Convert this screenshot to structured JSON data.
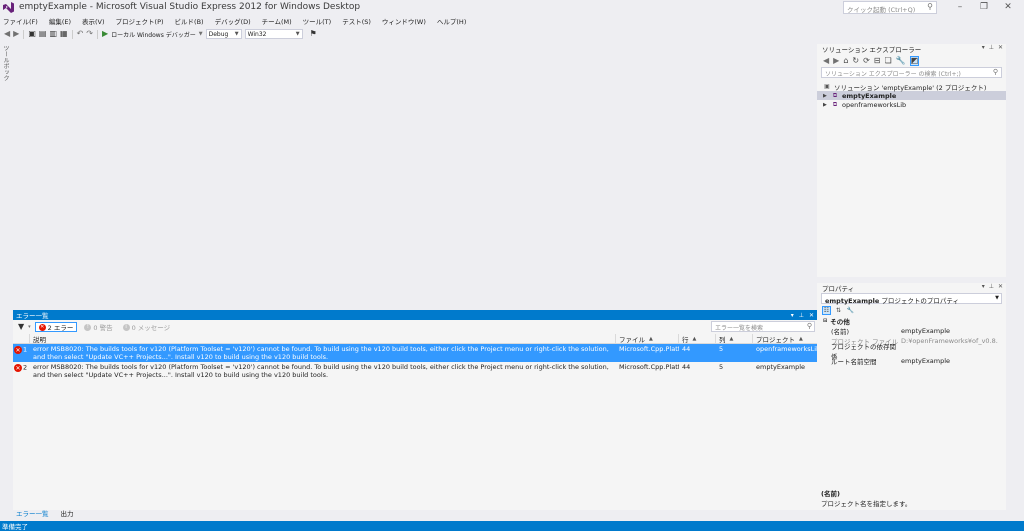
{
  "window": {
    "title": "emptyExample - Microsoft Visual Studio Express 2012 for Windows Desktop",
    "quick_launch_placeholder": "クイック起動 (Ctrl+Q)",
    "controls": [
      "minimize",
      "restore",
      "close"
    ]
  },
  "menu": [
    "ファイル(F)",
    "編集(E)",
    "表示(V)",
    "プロジェクト(P)",
    "ビルド(B)",
    "デバッグ(D)",
    "チーム(M)",
    "ツール(T)",
    "テスト(S)",
    "ウィンドウ(W)",
    "ヘルプ(H)"
  ],
  "toolbar": {
    "debugger_label": "ローカル Windows デバッガー",
    "configuration": "Debug",
    "platform": "Win32"
  },
  "toolbox_tab": "ツールボックス",
  "solution_explorer": {
    "title": "ソリューション エクスプローラー",
    "search_placeholder": "ソリューション エクスプローラー の検索 (Ctrl+;)",
    "items": [
      {
        "label": "ソリューション 'emptyExample' (2 プロジェクト)",
        "level": 0,
        "selected": false,
        "bold": false
      },
      {
        "label": "emptyExample",
        "level": 1,
        "selected": true,
        "bold": true
      },
      {
        "label": "openframeworksLib",
        "level": 1,
        "selected": false,
        "bold": false
      }
    ]
  },
  "properties": {
    "title": "プロパティ",
    "selector_name": "emptyExample",
    "selector_type": "プロジェクトのプロパティ",
    "category": "その他",
    "rows": [
      {
        "name": "(名前)",
        "value": "emptyExample",
        "dim": false
      },
      {
        "name": "プロジェクト ファイル",
        "value": "D:¥openFrameworks¥of_v0.8.",
        "dim": true
      },
      {
        "name": "プロジェクトの依存関係",
        "value": "",
        "dim": false
      },
      {
        "name": "ルート名前空間",
        "value": "emptyExample",
        "dim": false
      }
    ],
    "description_title": "(名前)",
    "description_text": "プロジェクト名を指定します。"
  },
  "error_list": {
    "title": "エラー一覧",
    "filters": {
      "errors": "2 エラー",
      "warnings": "0 警告",
      "messages": "0 メッセージ"
    },
    "search_placeholder": "エラー一覧を検索",
    "columns": [
      "説明",
      "ファイル",
      "行",
      "列",
      "プロジェクト"
    ],
    "rows": [
      {
        "num": "1",
        "description": "error MSB8020: The builds tools for v120 (Platform Toolset = 'v120') cannot be found. To build using the v120 build tools, either click the Project menu or right-click the solution, and then select \"Update VC++ Projects...\". Install v120 to build using the v120 build tools.",
        "file": "Microsoft.Cpp.Platfo",
        "line": "44",
        "col": "5",
        "project": "openframeworksLib",
        "selected": true
      },
      {
        "num": "2",
        "description": "error MSB8020: The builds tools for v120 (Platform Toolset = 'v120') cannot be found. To build using the v120 build tools, either click the Project menu or right-click the solution, and then select \"Update VC++ Projects...\". Install v120 to build using the v120 build tools.",
        "file": "Microsoft.Cpp.Platfo",
        "line": "44",
        "col": "5",
        "project": "emptyExample",
        "selected": false
      }
    ],
    "tabs": [
      "エラー一覧",
      "出力"
    ]
  },
  "status": "準備完了",
  "colors": {
    "accent": "#007acc",
    "selection": "#3399ff",
    "error": "#e51400",
    "background": "#eeeef2"
  }
}
